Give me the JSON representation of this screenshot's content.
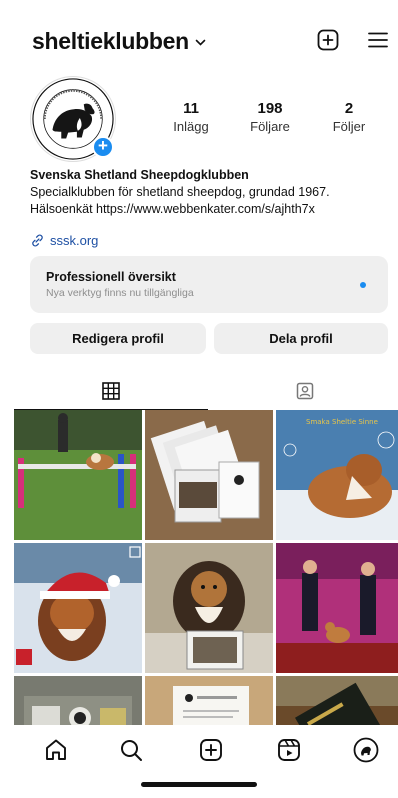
{
  "header": {
    "username": "sheltieklubben",
    "new_post_icon": "plus-square-icon",
    "menu_icon": "hamburger-menu-icon"
  },
  "profile": {
    "avatar": "club-logo-avatar",
    "stats": [
      {
        "value": "11",
        "label": "Inlägg"
      },
      {
        "value": "198",
        "label": "Följare"
      },
      {
        "value": "2",
        "label": "Följer"
      }
    ],
    "bio_name": "Svenska Shetland Sheepdogklubben",
    "bio_line1": "Specialklubben för shetland sheepdog, grundad 1967.",
    "bio_line2": "Hälsoenkät https://www.webbenkater.com/s/ajhth7x",
    "website": "sssk.org"
  },
  "professional": {
    "title": "Professionell översikt",
    "subtitle": "Nya verktyg finns nu tillgängliga"
  },
  "buttons": {
    "edit": "Redigera profil",
    "share": "Dela profil"
  },
  "tabs": [
    {
      "icon": "grid-icon",
      "active": true
    },
    {
      "icon": "tagged-person-icon",
      "active": false
    }
  ],
  "posts": [
    {
      "scene": "agility-dog-jump"
    },
    {
      "scene": "magazines-fanned"
    },
    {
      "scene": "sheltie-snow-bubbles"
    },
    {
      "scene": "sheltie-santa-hat"
    },
    {
      "scene": "sheltie-with-photo"
    },
    {
      "scene": "dog-show-winners"
    },
    {
      "scene": "sticker-sheet"
    },
    {
      "scene": "booklet"
    },
    {
      "scene": "book-on-table"
    }
  ],
  "bottom_nav": [
    {
      "icon": "home-icon"
    },
    {
      "icon": "search-icon"
    },
    {
      "icon": "create-icon"
    },
    {
      "icon": "reels-icon"
    },
    {
      "icon": "profile-avatar-icon"
    }
  ]
}
